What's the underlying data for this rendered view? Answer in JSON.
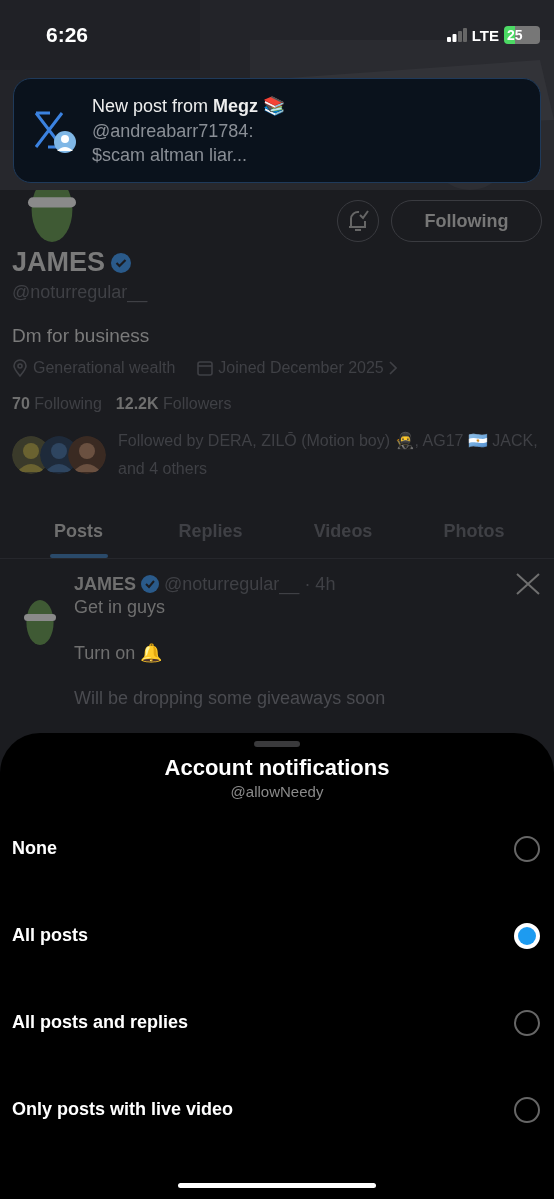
{
  "status_bar": {
    "time": "6:26",
    "network": "LTE",
    "battery": "25"
  },
  "notification": {
    "title": "New post from **Megz** 📚",
    "sender": "@andreabarr71784:",
    "text": "$scam altman liar..."
  },
  "profile": {
    "name": "JAMES",
    "handle": "@noturregular__",
    "bio": "Dm for business",
    "location": "Generational wealth",
    "joined": "Joined December 2025",
    "following": "**70** Following",
    "followers": "**12.2K** Followers",
    "followed_by": "Followed by DERA, ZILŌ (Motion boy) 🥷, AG17 🇦🇷 JACK, and 4 others",
    "follow_button": "Following"
  },
  "tabs": [
    {
      "label": "Posts",
      "selected": true
    },
    {
      "label": "Replies",
      "selected": false
    },
    {
      "label": "Videos",
      "selected": false
    },
    {
      "label": "Photos",
      "selected": false
    }
  ],
  "post": {
    "author": "JAMES",
    "handle": "@noturregular__",
    "time": "· 4h",
    "lines": [
      "Get in guys",
      "Turn on 🔔",
      "Will be dropping some giveaways soon"
    ]
  },
  "sheet": {
    "title": "Account notifications",
    "subtitle": "@allowNeedy",
    "options": [
      {
        "label": "None",
        "selected": false
      },
      {
        "label": "All posts",
        "selected": true
      },
      {
        "label": "All posts and replies",
        "selected": false
      },
      {
        "label": "Only posts with live video",
        "selected": false
      }
    ]
  }
}
